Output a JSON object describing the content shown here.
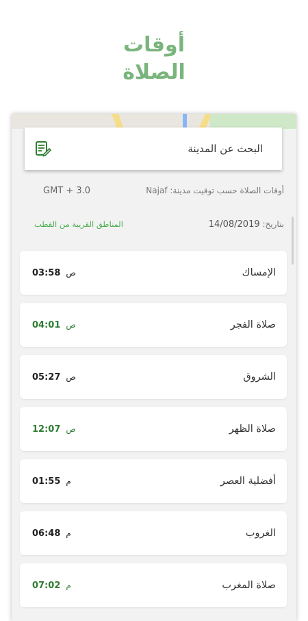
{
  "header": {
    "title_line1": "أوقات",
    "title_line2": "الصلاة"
  },
  "search": {
    "label": "البحث عن المدينة",
    "icon": "edit-note-icon"
  },
  "info": {
    "city_text": "أوقات الصلاة حسب توقيت مدينة: Najaf",
    "gmt": "GMT + 3.0",
    "date_label": "بتاريخ:",
    "date_value": "14/08/2019",
    "nearby_link": "المناطق القريبة من القطب"
  },
  "prayers": [
    {
      "name": "الإمساك",
      "time": "03:58",
      "ampm": "ص",
      "highlight": false
    },
    {
      "name": "صلاة الفجر",
      "time": "04:01",
      "ampm": "ص",
      "highlight": true
    },
    {
      "name": "الشروق",
      "time": "05:27",
      "ampm": "ص",
      "highlight": false
    },
    {
      "name": "صلاة الظهر",
      "time": "12:07",
      "ampm": "ص",
      "highlight": true
    },
    {
      "name": "أفضلية العصر",
      "time": "01:55",
      "ampm": "م",
      "highlight": false
    },
    {
      "name": "الغروب",
      "time": "06:48",
      "ampm": "م",
      "highlight": false
    },
    {
      "name": "صلاة المغرب",
      "time": "07:02",
      "ampm": "م",
      "highlight": true
    }
  ],
  "colors": {
    "accent": "#7ab57d",
    "highlight_time": "#2e7d32",
    "link": "#4caf50"
  }
}
